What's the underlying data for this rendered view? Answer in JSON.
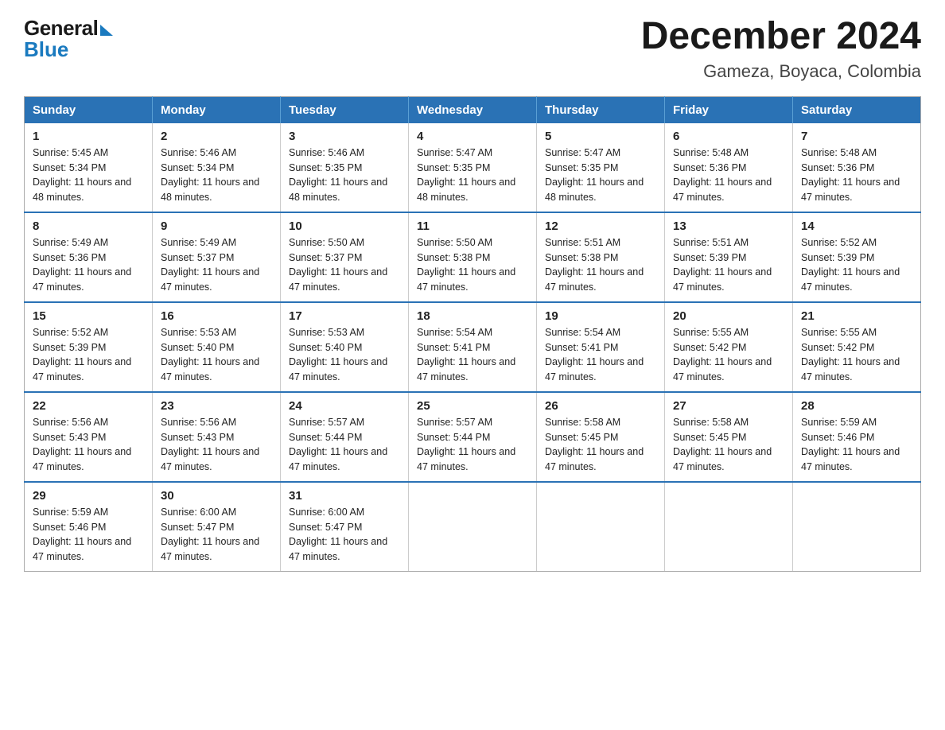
{
  "header": {
    "logo_general": "General",
    "logo_blue": "Blue",
    "month_title": "December 2024",
    "location": "Gameza, Boyaca, Colombia"
  },
  "weekdays": [
    "Sunday",
    "Monday",
    "Tuesday",
    "Wednesday",
    "Thursday",
    "Friday",
    "Saturday"
  ],
  "weeks": [
    [
      {
        "day": "1",
        "sunrise": "Sunrise: 5:45 AM",
        "sunset": "Sunset: 5:34 PM",
        "daylight": "Daylight: 11 hours and 48 minutes."
      },
      {
        "day": "2",
        "sunrise": "Sunrise: 5:46 AM",
        "sunset": "Sunset: 5:34 PM",
        "daylight": "Daylight: 11 hours and 48 minutes."
      },
      {
        "day": "3",
        "sunrise": "Sunrise: 5:46 AM",
        "sunset": "Sunset: 5:35 PM",
        "daylight": "Daylight: 11 hours and 48 minutes."
      },
      {
        "day": "4",
        "sunrise": "Sunrise: 5:47 AM",
        "sunset": "Sunset: 5:35 PM",
        "daylight": "Daylight: 11 hours and 48 minutes."
      },
      {
        "day": "5",
        "sunrise": "Sunrise: 5:47 AM",
        "sunset": "Sunset: 5:35 PM",
        "daylight": "Daylight: 11 hours and 48 minutes."
      },
      {
        "day": "6",
        "sunrise": "Sunrise: 5:48 AM",
        "sunset": "Sunset: 5:36 PM",
        "daylight": "Daylight: 11 hours and 47 minutes."
      },
      {
        "day": "7",
        "sunrise": "Sunrise: 5:48 AM",
        "sunset": "Sunset: 5:36 PM",
        "daylight": "Daylight: 11 hours and 47 minutes."
      }
    ],
    [
      {
        "day": "8",
        "sunrise": "Sunrise: 5:49 AM",
        "sunset": "Sunset: 5:36 PM",
        "daylight": "Daylight: 11 hours and 47 minutes."
      },
      {
        "day": "9",
        "sunrise": "Sunrise: 5:49 AM",
        "sunset": "Sunset: 5:37 PM",
        "daylight": "Daylight: 11 hours and 47 minutes."
      },
      {
        "day": "10",
        "sunrise": "Sunrise: 5:50 AM",
        "sunset": "Sunset: 5:37 PM",
        "daylight": "Daylight: 11 hours and 47 minutes."
      },
      {
        "day": "11",
        "sunrise": "Sunrise: 5:50 AM",
        "sunset": "Sunset: 5:38 PM",
        "daylight": "Daylight: 11 hours and 47 minutes."
      },
      {
        "day": "12",
        "sunrise": "Sunrise: 5:51 AM",
        "sunset": "Sunset: 5:38 PM",
        "daylight": "Daylight: 11 hours and 47 minutes."
      },
      {
        "day": "13",
        "sunrise": "Sunrise: 5:51 AM",
        "sunset": "Sunset: 5:39 PM",
        "daylight": "Daylight: 11 hours and 47 minutes."
      },
      {
        "day": "14",
        "sunrise": "Sunrise: 5:52 AM",
        "sunset": "Sunset: 5:39 PM",
        "daylight": "Daylight: 11 hours and 47 minutes."
      }
    ],
    [
      {
        "day": "15",
        "sunrise": "Sunrise: 5:52 AM",
        "sunset": "Sunset: 5:39 PM",
        "daylight": "Daylight: 11 hours and 47 minutes."
      },
      {
        "day": "16",
        "sunrise": "Sunrise: 5:53 AM",
        "sunset": "Sunset: 5:40 PM",
        "daylight": "Daylight: 11 hours and 47 minutes."
      },
      {
        "day": "17",
        "sunrise": "Sunrise: 5:53 AM",
        "sunset": "Sunset: 5:40 PM",
        "daylight": "Daylight: 11 hours and 47 minutes."
      },
      {
        "day": "18",
        "sunrise": "Sunrise: 5:54 AM",
        "sunset": "Sunset: 5:41 PM",
        "daylight": "Daylight: 11 hours and 47 minutes."
      },
      {
        "day": "19",
        "sunrise": "Sunrise: 5:54 AM",
        "sunset": "Sunset: 5:41 PM",
        "daylight": "Daylight: 11 hours and 47 minutes."
      },
      {
        "day": "20",
        "sunrise": "Sunrise: 5:55 AM",
        "sunset": "Sunset: 5:42 PM",
        "daylight": "Daylight: 11 hours and 47 minutes."
      },
      {
        "day": "21",
        "sunrise": "Sunrise: 5:55 AM",
        "sunset": "Sunset: 5:42 PM",
        "daylight": "Daylight: 11 hours and 47 minutes."
      }
    ],
    [
      {
        "day": "22",
        "sunrise": "Sunrise: 5:56 AM",
        "sunset": "Sunset: 5:43 PM",
        "daylight": "Daylight: 11 hours and 47 minutes."
      },
      {
        "day": "23",
        "sunrise": "Sunrise: 5:56 AM",
        "sunset": "Sunset: 5:43 PM",
        "daylight": "Daylight: 11 hours and 47 minutes."
      },
      {
        "day": "24",
        "sunrise": "Sunrise: 5:57 AM",
        "sunset": "Sunset: 5:44 PM",
        "daylight": "Daylight: 11 hours and 47 minutes."
      },
      {
        "day": "25",
        "sunrise": "Sunrise: 5:57 AM",
        "sunset": "Sunset: 5:44 PM",
        "daylight": "Daylight: 11 hours and 47 minutes."
      },
      {
        "day": "26",
        "sunrise": "Sunrise: 5:58 AM",
        "sunset": "Sunset: 5:45 PM",
        "daylight": "Daylight: 11 hours and 47 minutes."
      },
      {
        "day": "27",
        "sunrise": "Sunrise: 5:58 AM",
        "sunset": "Sunset: 5:45 PM",
        "daylight": "Daylight: 11 hours and 47 minutes."
      },
      {
        "day": "28",
        "sunrise": "Sunrise: 5:59 AM",
        "sunset": "Sunset: 5:46 PM",
        "daylight": "Daylight: 11 hours and 47 minutes."
      }
    ],
    [
      {
        "day": "29",
        "sunrise": "Sunrise: 5:59 AM",
        "sunset": "Sunset: 5:46 PM",
        "daylight": "Daylight: 11 hours and 47 minutes."
      },
      {
        "day": "30",
        "sunrise": "Sunrise: 6:00 AM",
        "sunset": "Sunset: 5:47 PM",
        "daylight": "Daylight: 11 hours and 47 minutes."
      },
      {
        "day": "31",
        "sunrise": "Sunrise: 6:00 AM",
        "sunset": "Sunset: 5:47 PM",
        "daylight": "Daylight: 11 hours and 47 minutes."
      },
      null,
      null,
      null,
      null
    ]
  ]
}
